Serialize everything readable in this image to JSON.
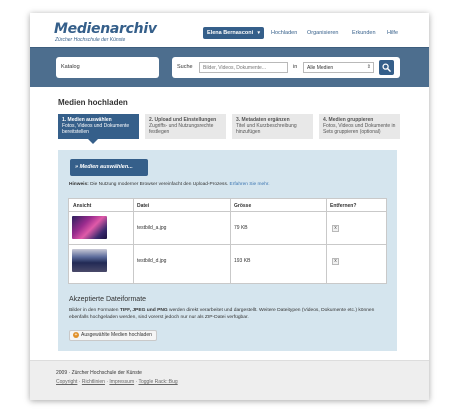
{
  "header": {
    "logo_title": "Medienarchiv",
    "logo_subtitle": "Zürcher Hochschule der Künste",
    "user_name": "Elena Bernasconi",
    "nav": [
      "Hochladen",
      "Organisieren",
      "Erkunden",
      "Hilfe"
    ]
  },
  "searchbar": {
    "katalog_label": "Katalog",
    "search_label": "Suche",
    "search_placeholder": "Bilder, Videos, Dokumente...",
    "in_label": "in",
    "scope_value": "Alle Medien"
  },
  "page": {
    "title": "Medien hochladen"
  },
  "steps": [
    {
      "title": "1. Medien auswählen",
      "desc": "Fotos, Videos und Dokumente bereitstellen",
      "active": true
    },
    {
      "title": "2. Upload und Einstellungen",
      "desc": "Zugriffs- und Nutzungsrechte festlegen",
      "active": false
    },
    {
      "title": "3. Metadaten ergänzen",
      "desc": "Titel und Kurzbeschreibung hinzufügen",
      "active": false
    },
    {
      "title": "4. Medien gruppieren",
      "desc": "Fotos, Videos und Dokumente in Sets gruppieren (optional)",
      "active": false
    }
  ],
  "uploader": {
    "select_button": "» Medien auswählen...",
    "hint_prefix": "Hinweis:",
    "hint_text": "Die Nutzung moderner Browser vereinfacht den Upload-Prozess.",
    "hint_link": "Erfahren Sie mehr."
  },
  "table": {
    "headers": [
      "Ansicht",
      "Datei",
      "Grösse",
      "Entfernen?"
    ],
    "rows": [
      {
        "file": "testbild_a.jpg",
        "size": "79 KB",
        "remove": "x"
      },
      {
        "file": "testbild_d.jpg",
        "size": "193 KB",
        "remove": "x"
      }
    ]
  },
  "formats": {
    "title": "Akzeptierte Dateiformate",
    "line1_a": "Bilder in den Formaten ",
    "line1_b": "TIFF, JPEG und PNG",
    "line1_c": " werden direkt verarbeitet und dargestellt. Weitere Dateitypen (Videos, Dokumente etc.) können",
    "line2": "ebenfalls hochgeladen werden, sind vorerst jedoch nur nur als ZIP-Datei verfügbar.",
    "upload_button": "Ausgewählte Medien hochladen"
  },
  "footer": {
    "copyright": "2009 · Zürcher Hochschule der Künste",
    "links": [
      "Copyright",
      "Richtlinien",
      "Impressum",
      "Toggle Rack::Bug"
    ],
    "separator": " · "
  },
  "colors": {
    "brand_blue": "#355f8a",
    "searchbar_bg": "#4d6e8e",
    "panel_bg": "#d5e5ee",
    "accent_orange": "#e0902a"
  }
}
